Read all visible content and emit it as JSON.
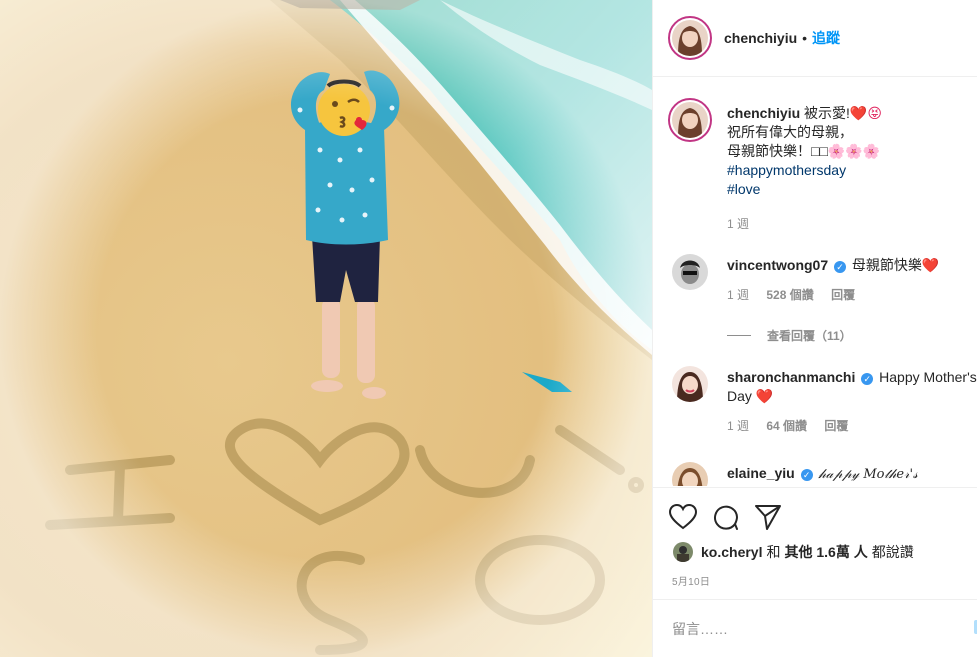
{
  "post": {
    "photo_icon": "beach-photo-heart-in-sand",
    "author": "chenchiyiu",
    "follow_label": "追蹤",
    "dot": "•"
  },
  "caption": {
    "author": "chenchiyiu",
    "line1": "被示愛!",
    "line1_emoji": "❤️😝",
    "line2": "祝所有偉大的母親，",
    "line3": "母親節快樂！",
    "line3_emoji": "□□🌸🌸🌸",
    "hashtag1": "#happymothersday",
    "hashtag2": "#love",
    "time": "1 週"
  },
  "comments": [
    {
      "user": "vincentwong07",
      "text": "母親節快樂",
      "emoji": "❤️",
      "time": "1 週",
      "likes": "528 個讚",
      "reply": "回覆",
      "view_replies": "查看回覆（11）"
    },
    {
      "user": "sharonchanmanchi",
      "text": "Happy Mother's Day",
      "emoji": "❤️",
      "time": "1 週",
      "likes": "64 個讚",
      "reply": "回覆"
    },
    {
      "user": "elaine_yiu",
      "text": "𝒽𝒶𝓅𝓅𝓎 𝑀𝑜𝓉𝒽𝑒𝓇'𝓈"
    }
  ],
  "likes": {
    "user": "ko.cheryl",
    "text_pre": "和",
    "text_others": "其他 1.6萬 人",
    "text_post": "都說讚"
  },
  "date": "5月10日",
  "add_comment": {
    "placeholder": "留言……"
  },
  "colors": {
    "link": "#0095f6",
    "hashtag": "#00376b",
    "muted": "#8e8e8e",
    "verified": "#3897f0"
  }
}
